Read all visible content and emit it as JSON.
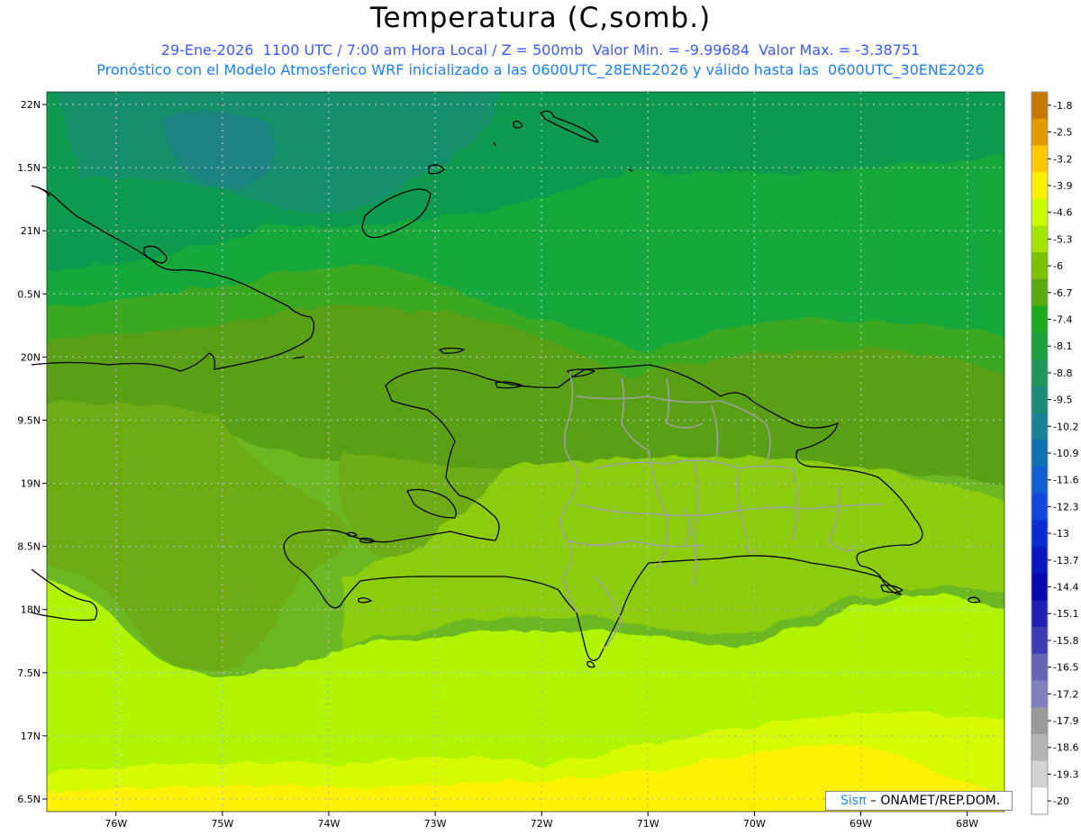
{
  "title": "Temperatura (C,somb.)",
  "subtitle1": "29-Ene-2026  1100 UTC / 7:00 am Hora Local / Z = 500mb  Valor Min. = -9.99684  Valor Max. = -3.38751",
  "subtitle2": "Pronóstico con el Modelo Atmosferico WRF inicializado a las 0600UTC_28ENE2026 y válido hasta las  0600UTC_30ENE2026",
  "credit": {
    "brand": "Sisπ",
    "text": "– ONAMET/REP.DOM."
  },
  "colors": {
    "grid": "#b8b8b8",
    "coast": "#000000",
    "border": "#a0a0a0",
    "bluetext": "#3a5bff"
  },
  "chart_data": {
    "type": "heatmap",
    "lon_ticks": [
      "76W",
      "75W",
      "74W",
      "73W",
      "72W",
      "71W",
      "70W",
      "69W",
      "68W"
    ],
    "lat_ticks": [
      "22N",
      "1.5N",
      "21N",
      "0.5N",
      "20N",
      "9.5N",
      "19N",
      "8.5N",
      "18N",
      "7.5N",
      "17N",
      "6.5N"
    ],
    "xlim": [
      -76.65,
      -67.65
    ],
    "ylim": [
      16.4,
      22.1
    ],
    "colorbar": {
      "labels": [
        "-1.8",
        "-2.5",
        "-3.2",
        "-3.9",
        "-4.6",
        "-5.3",
        "-6",
        "-6.7",
        "-7.4",
        "-8.1",
        "-8.8",
        "-9.5",
        "-10.2",
        "-10.9",
        "-11.6",
        "-12.3",
        "-13",
        "-13.7",
        "-14.4",
        "-15.1",
        "-15.8",
        "-16.5",
        "-17.2",
        "-17.9",
        "-18.6",
        "-19.3",
        "-20"
      ],
      "colors": [
        "#c47a00",
        "#e09a00",
        "#ffc800",
        "#fff000",
        "#c8ff00",
        "#a4e600",
        "#7cc000",
        "#58aa10",
        "#1eaa1e",
        "#1ea03c",
        "#20965a",
        "#1a8c78",
        "#188296",
        "#1070b4",
        "#1060d2",
        "#1048dc",
        "#0a2ad2",
        "#0818c0",
        "#0808b0",
        "#2020b4",
        "#3c3cb4",
        "#6464b4",
        "#8080c0",
        "#9a9a9a",
        "#b4b4b4",
        "#d2d2d2",
        "#ffffff"
      ]
    },
    "field_classes": [
      "-3.9",
      "-4.6",
      "-5.3",
      "-6",
      "-6.7",
      "-7.4",
      "-8.1",
      "-8.8",
      "-9.5"
    ]
  }
}
